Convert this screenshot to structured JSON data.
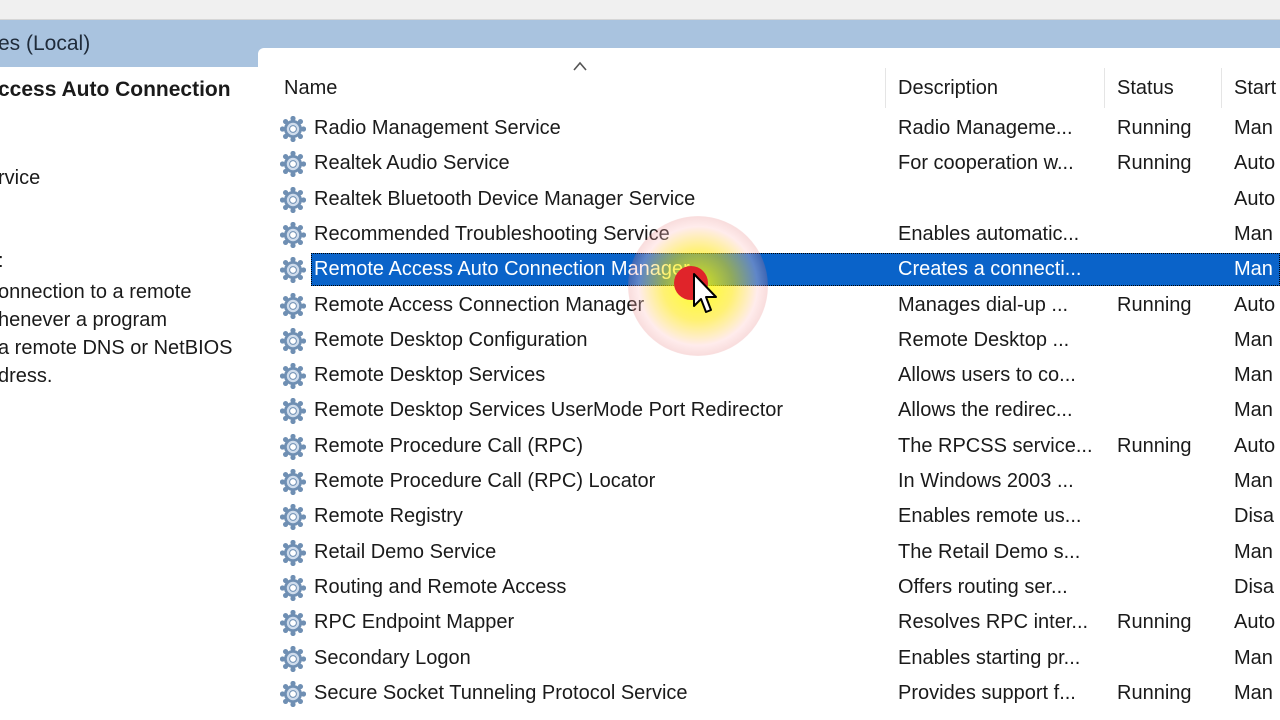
{
  "header": {
    "title": "es (Local)"
  },
  "left_pane": {
    "selected_service_title": "ccess Auto Connection",
    "link_text": "rvice",
    "description_label": ":",
    "description_lines": [
      "onnection to a remote",
      "henever a program",
      "a remote DNS or NetBIOS",
      "dress."
    ]
  },
  "columns": {
    "name": "Name",
    "description": "Description",
    "status": "Status",
    "startup": "Start"
  },
  "services": [
    {
      "name": "Radio Management Service",
      "description": "Radio Manageme...",
      "status": "Running",
      "startup": "Man"
    },
    {
      "name": "Realtek Audio Service",
      "description": "For cooperation w...",
      "status": "Running",
      "startup": "Auto"
    },
    {
      "name": "Realtek Bluetooth Device Manager Service",
      "description": "",
      "status": "",
      "startup": "Auto"
    },
    {
      "name": "Recommended Troubleshooting Service",
      "description": "Enables automatic...",
      "status": "",
      "startup": "Man"
    },
    {
      "name": "Remote Access Auto Connection Manager",
      "description": "Creates a connecti...",
      "status": "",
      "startup": "Man",
      "selected": true
    },
    {
      "name": "Remote Access Connection Manager",
      "description": "Manages dial-up ...",
      "status": "Running",
      "startup": "Auto"
    },
    {
      "name": "Remote Desktop Configuration",
      "description": "Remote Desktop ...",
      "status": "",
      "startup": "Man"
    },
    {
      "name": "Remote Desktop Services",
      "description": "Allows users to co...",
      "status": "",
      "startup": "Man"
    },
    {
      "name": "Remote Desktop Services UserMode Port Redirector",
      "description": "Allows the redirec...",
      "status": "",
      "startup": "Man"
    },
    {
      "name": "Remote Procedure Call (RPC)",
      "description": "The RPCSS service...",
      "status": "Running",
      "startup": "Auto"
    },
    {
      "name": "Remote Procedure Call (RPC) Locator",
      "description": "In Windows 2003 ...",
      "status": "",
      "startup": "Man"
    },
    {
      "name": "Remote Registry",
      "description": "Enables remote us...",
      "status": "",
      "startup": "Disa"
    },
    {
      "name": "Retail Demo Service",
      "description": "The Retail Demo s...",
      "status": "",
      "startup": "Man"
    },
    {
      "name": "Routing and Remote Access",
      "description": "Offers routing ser...",
      "status": "",
      "startup": "Disa"
    },
    {
      "name": "RPC Endpoint Mapper",
      "description": "Resolves RPC inter...",
      "status": "Running",
      "startup": "Auto"
    },
    {
      "name": "Secondary Logon",
      "description": "Enables starting pr...",
      "status": "",
      "startup": "Man"
    },
    {
      "name": "Secure Socket Tunneling Protocol Service",
      "description": "Provides support f...",
      "status": "Running",
      "startup": "Man"
    }
  ],
  "colors": {
    "header_band": "#a9c3df",
    "selection": "#0a63c9",
    "gear_icon": "#6f8fb3"
  }
}
